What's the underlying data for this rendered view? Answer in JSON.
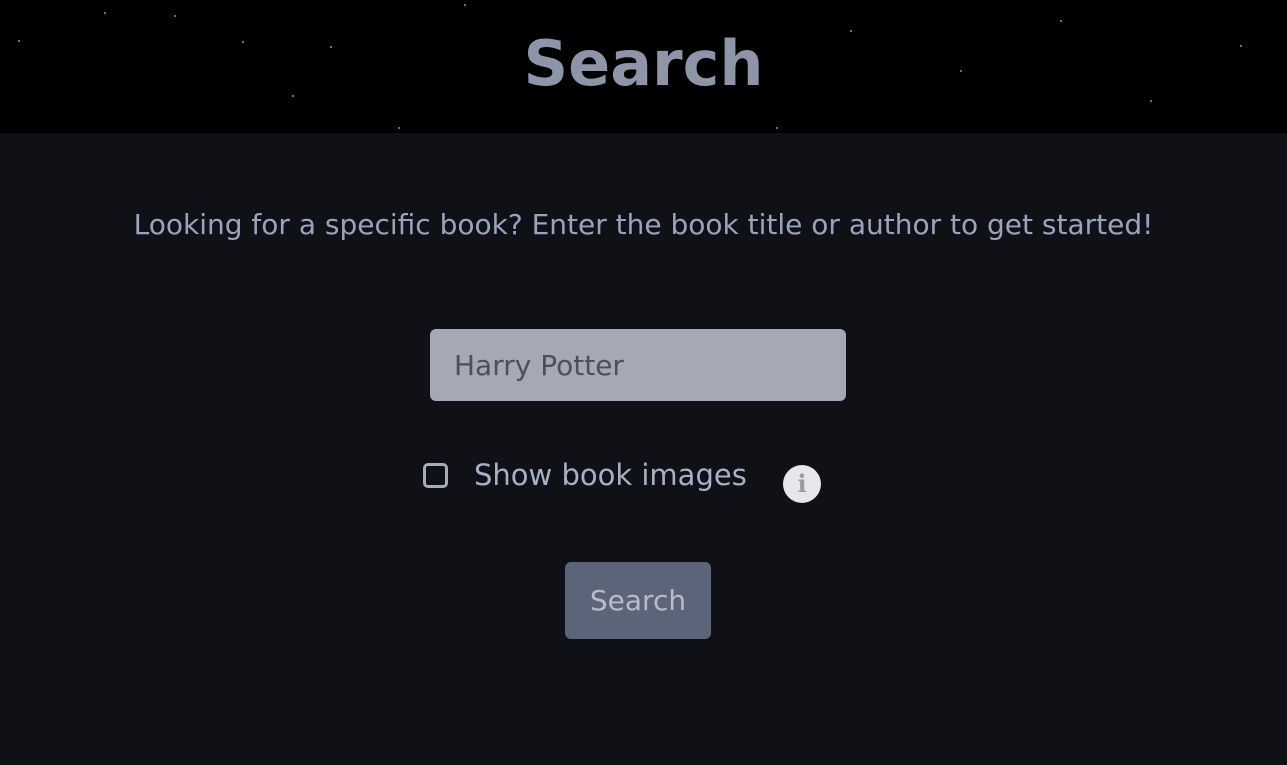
{
  "header": {
    "title": "Search"
  },
  "intro_text": "Looking for a specific book? Enter the book title or author to get started!",
  "search": {
    "placeholder": "Harry Potter",
    "value": ""
  },
  "options": {
    "show_images_label": "Show book images",
    "show_images_checked": false,
    "info_icon": "info-icon"
  },
  "actions": {
    "search_label": "Search"
  },
  "colors": {
    "page_background": "#101116",
    "header_background": "#000000",
    "title": "#8f95a8",
    "text": "#9aa3be",
    "input_background": "#a4a9b5",
    "button_background": "#5c6479"
  }
}
